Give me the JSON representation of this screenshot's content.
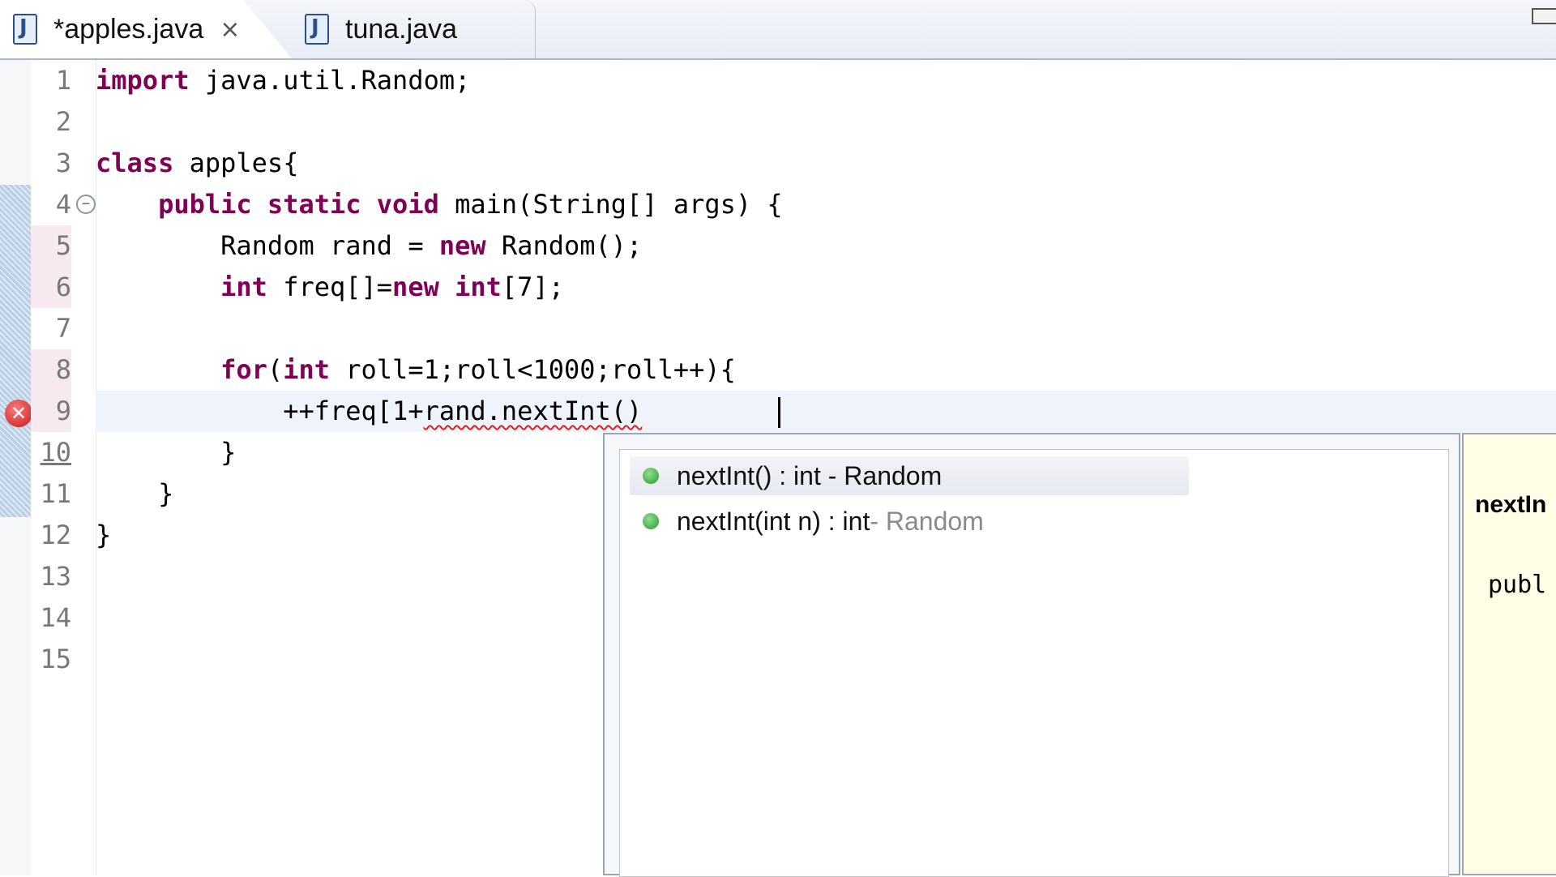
{
  "tabs": [
    {
      "label": "*apples.java",
      "active": true,
      "close_glyph": "×"
    },
    {
      "label": "tuna.java",
      "active": false
    }
  ],
  "editor": {
    "line_numbers": [
      "1",
      "2",
      "3",
      "4",
      "5",
      "6",
      "7",
      "8",
      "9",
      "10",
      "11",
      "12",
      "13",
      "14",
      "15"
    ],
    "code": {
      "l1_kw": "import",
      "l1_rest": " java.util.Random;",
      "l3_kw": "class",
      "l3_rest": " apples{",
      "l4_indent": "    ",
      "l4_kw1": "public",
      "l4_sp1": " ",
      "l4_kw2": "static",
      "l4_sp2": " ",
      "l4_kw3": "void",
      "l4_rest": " main(String[] args) {",
      "l5_a": "        Random rand = ",
      "l5_kw": "new",
      "l5_b": " Random();",
      "l6_indent": "        ",
      "l6_kw1": "int",
      "l6_a": " freq[]=",
      "l6_kw2": "new",
      "l6_sp": " ",
      "l6_kw3": "int",
      "l6_b": "[7];",
      "l8_indent": "        ",
      "l8_kw1": "for",
      "l8_a": "(",
      "l8_kw2": "int",
      "l8_b": " roll=1;roll<1000;roll++){",
      "l9_a": "            ++freq[1+",
      "l9_err": "rand.nextInt()",
      "l9_b": "",
      "l10": "        }",
      "l11": "    }",
      "l12": "}"
    },
    "error_marker": "✕",
    "fold_marker": "−"
  },
  "content_assist": {
    "proposals": [
      {
        "label": "nextInt() : int - Random",
        "selected": true
      },
      {
        "label_main": "nextInt(int n) : int",
        "label_suffix": " - Random",
        "selected": false
      }
    ]
  },
  "javadoc_hover": {
    "title": "nextIn",
    "signature": "publ"
  },
  "colors": {
    "keyword": "#7f0055",
    "error": "#e02020",
    "proposal_icon": "#2a9a2a",
    "current_line": "#eef3fc"
  }
}
